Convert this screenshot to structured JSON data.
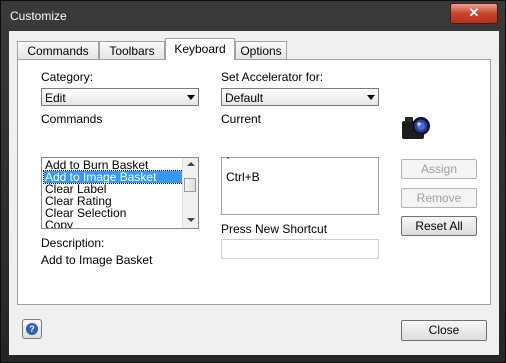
{
  "window": {
    "title": "Customize",
    "close_glyph": "✕"
  },
  "tabs": [
    {
      "label": "Commands"
    },
    {
      "label": "Toolbars"
    },
    {
      "label": "Keyboard"
    },
    {
      "label": "Options"
    }
  ],
  "active_tab": "Keyboard",
  "keyboard": {
    "category_label": "Category:",
    "category_value": "Edit",
    "commands_label": "Commands",
    "commands": [
      "Add to Burn Basket",
      "Add to Image Basket",
      "Clear Label",
      "Clear Rating",
      "Clear Selection",
      "Copy"
    ],
    "selected_command": "Add to Image Basket",
    "description_label": "Description:",
    "description_text": "Add to Image Basket",
    "set_accelerator_label": "Set Accelerator for:",
    "set_accelerator_value": "Default",
    "current_label": "Current",
    "current_keys": [
      "`",
      "Ctrl+B"
    ],
    "press_new_shortcut_label": "Press New Shortcut",
    "new_shortcut_value": "",
    "assign_label": "Assign",
    "remove_label": "Remove",
    "reset_all_label": "Reset All"
  },
  "footer": {
    "help_glyph": "?",
    "close_label": "Close"
  },
  "icons": {
    "camera": "camera-icon",
    "help": "help-icon",
    "close": "close-icon"
  },
  "colors": {
    "selection": "#3399ff",
    "title_bar": "#2e2e2e",
    "close_red": "#c7442b"
  }
}
